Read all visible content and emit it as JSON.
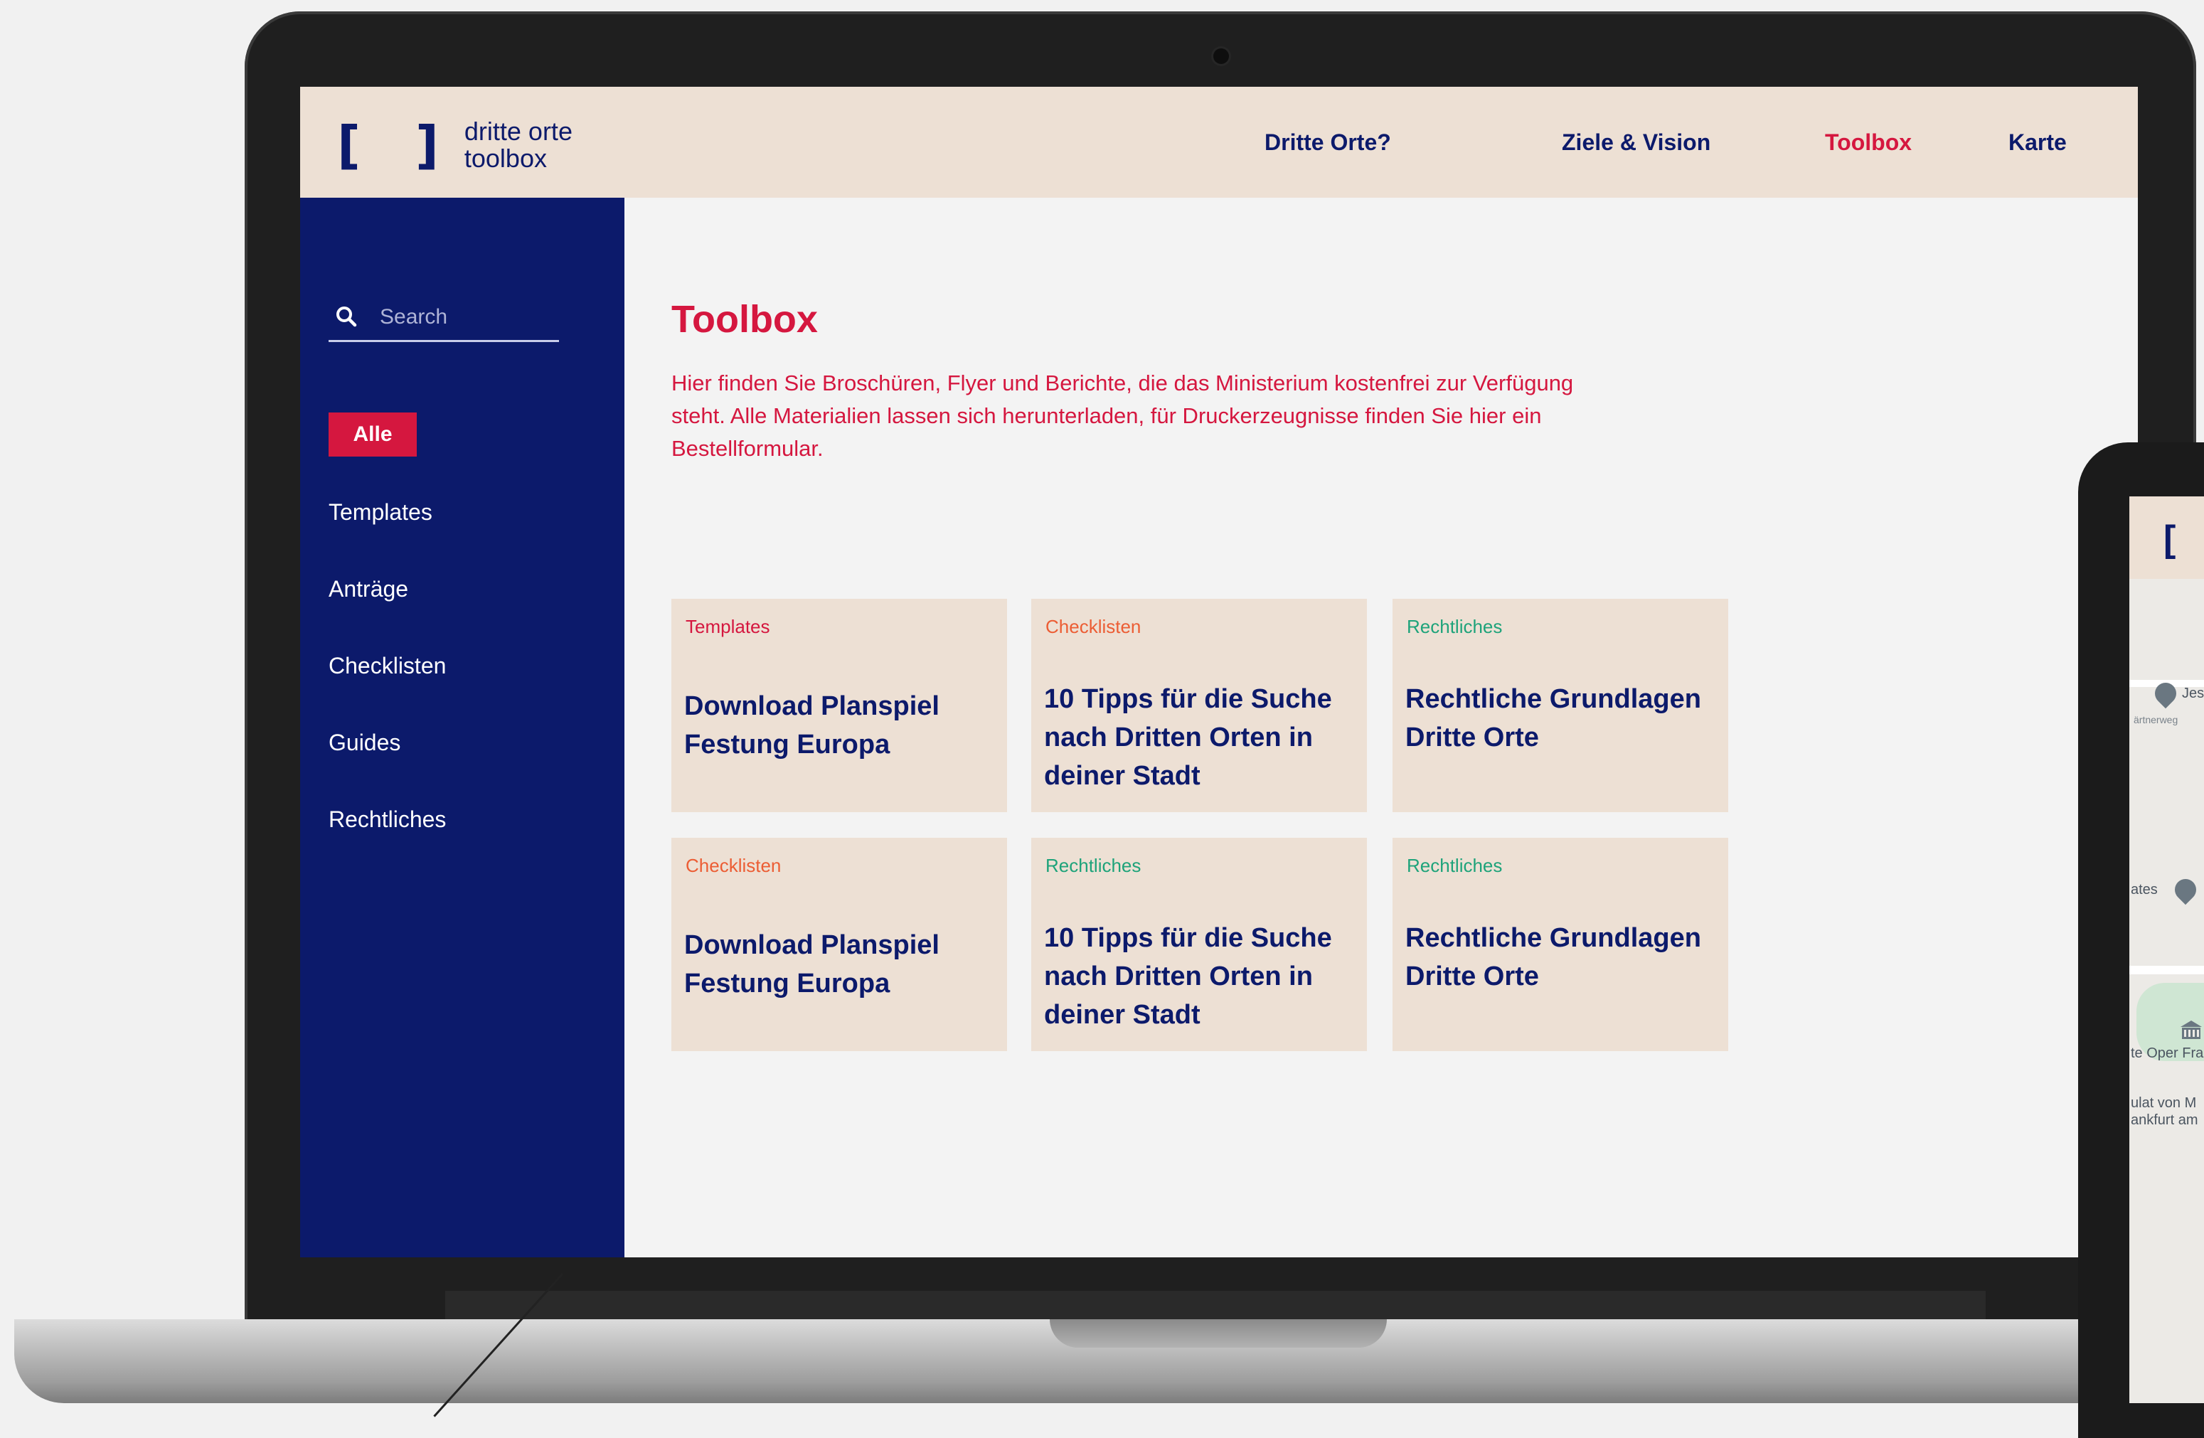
{
  "brand": {
    "logo_mark": "[ ]",
    "name_line1": "dritte orte",
    "name_line2": "toolbox"
  },
  "nav": {
    "items": [
      {
        "label": "Dritte Orte?",
        "active": false
      },
      {
        "label": "Ziele & Vision",
        "active": false
      },
      {
        "label": "Toolbox",
        "active": true
      },
      {
        "label": "Karte",
        "active": false
      }
    ]
  },
  "sidebar": {
    "search_placeholder": "Search",
    "search_icon": "search-icon",
    "active_filter": "Alle",
    "filters": [
      "Templates",
      "Anträge",
      "Checklisten",
      "Guides",
      "Rechtliches"
    ]
  },
  "main": {
    "title": "Toolbox",
    "intro": "Hier finden Sie Broschüren, Flyer und Berichte, die das Ministerium kostenfrei zur Verfügung steht. Alle Materialien lassen sich herunterladen, für Druckerzeugnisse finden Sie hier ein Bestellformular.",
    "cards": [
      {
        "category": "Templates",
        "title": "Download Planspiel Festung Europa"
      },
      {
        "category": "Checklisten",
        "title": "10 Tipps für die Suche nach Dritten Orten in deiner Stadt"
      },
      {
        "category": "Rechtliches",
        "title": "Rechtliche Grundlagen Dritte Orte"
      },
      {
        "category": "Checklisten",
        "title": "Download Planspiel Festung Europa"
      },
      {
        "category": "Rechtliches",
        "title": "10 Tipps für die Suche nach Dritten Orten in deiner Stadt"
      },
      {
        "category": "Rechtliches",
        "title": "Rechtliche Grundlagen Dritte Orte"
      }
    ]
  },
  "phone": {
    "bracket": "[",
    "map_labels": [
      "Jes",
      "ärtnerweg",
      "ates",
      "te Oper Fra",
      "ulat von M",
      "ankfurt am"
    ]
  },
  "colors": {
    "navy": "#0c1a6b",
    "accent_red": "#d5173f",
    "checklisten_orange": "#ec5d34",
    "rechtliches_green": "#1ea37a",
    "beige": "#ede0d4"
  }
}
